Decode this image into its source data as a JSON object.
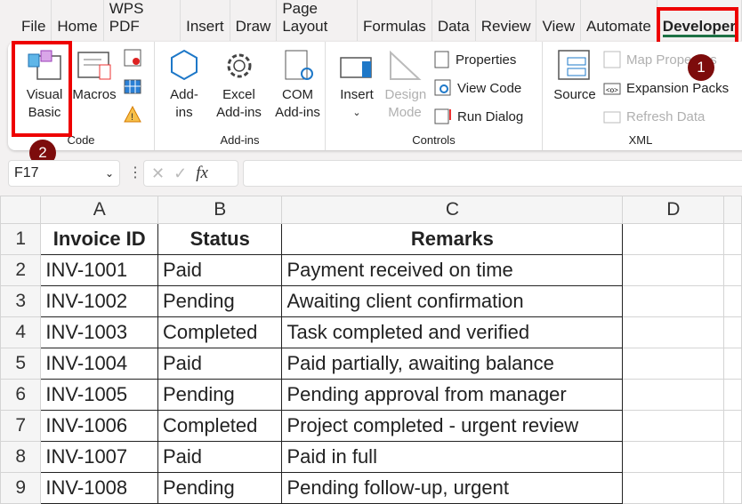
{
  "tabs": [
    "File",
    "Home",
    "WPS PDF",
    "Insert",
    "Draw",
    "Page Layout",
    "Formulas",
    "Data",
    "Review",
    "View",
    "Automate",
    "Developer"
  ],
  "ribbon": {
    "code": {
      "label": "Code",
      "visual_basic": "Visual Basic",
      "macros": "Macros"
    },
    "addins": {
      "label": "Add-ins",
      "addins": "Add-ins",
      "excel_addins": "Excel Add-ins",
      "com_addins": "COM Add-ins"
    },
    "controls": {
      "label": "Controls",
      "insert": "Insert",
      "design_mode": "Design Mode",
      "properties": "Properties",
      "view_code": "View Code",
      "run_dialog": "Run Dialog"
    },
    "xml": {
      "label": "XML",
      "source": "Source",
      "map_properties": "Map Properties",
      "expansion_packs": "Expansion Packs",
      "refresh_data": "Refresh Data"
    }
  },
  "badges": [
    "1",
    "2"
  ],
  "formula_bar": {
    "name_box": "F17",
    "fx": "fx",
    "formula": ""
  },
  "columns": [
    "A",
    "B",
    "C",
    "D"
  ],
  "rows": [
    [
      "Invoice ID",
      "Status",
      "Remarks"
    ],
    [
      "INV-1001",
      "Paid",
      "Payment received on time"
    ],
    [
      "INV-1002",
      "Pending",
      "Awaiting client confirmation"
    ],
    [
      "INV-1003",
      "Completed",
      "Task completed and verified"
    ],
    [
      "INV-1004",
      "Paid",
      "Paid partially, awaiting balance"
    ],
    [
      "INV-1005",
      "Pending",
      "Pending approval from manager"
    ],
    [
      "INV-1006",
      "Completed",
      "Project completed - urgent review"
    ],
    [
      "INV-1007",
      "Paid",
      "Paid in full"
    ],
    [
      "INV-1008",
      "Pending",
      "Pending follow-up, urgent"
    ]
  ],
  "colors": {
    "highlight": "#ee0000",
    "badge": "#7d0c0c",
    "accent": "#1e7145"
  }
}
